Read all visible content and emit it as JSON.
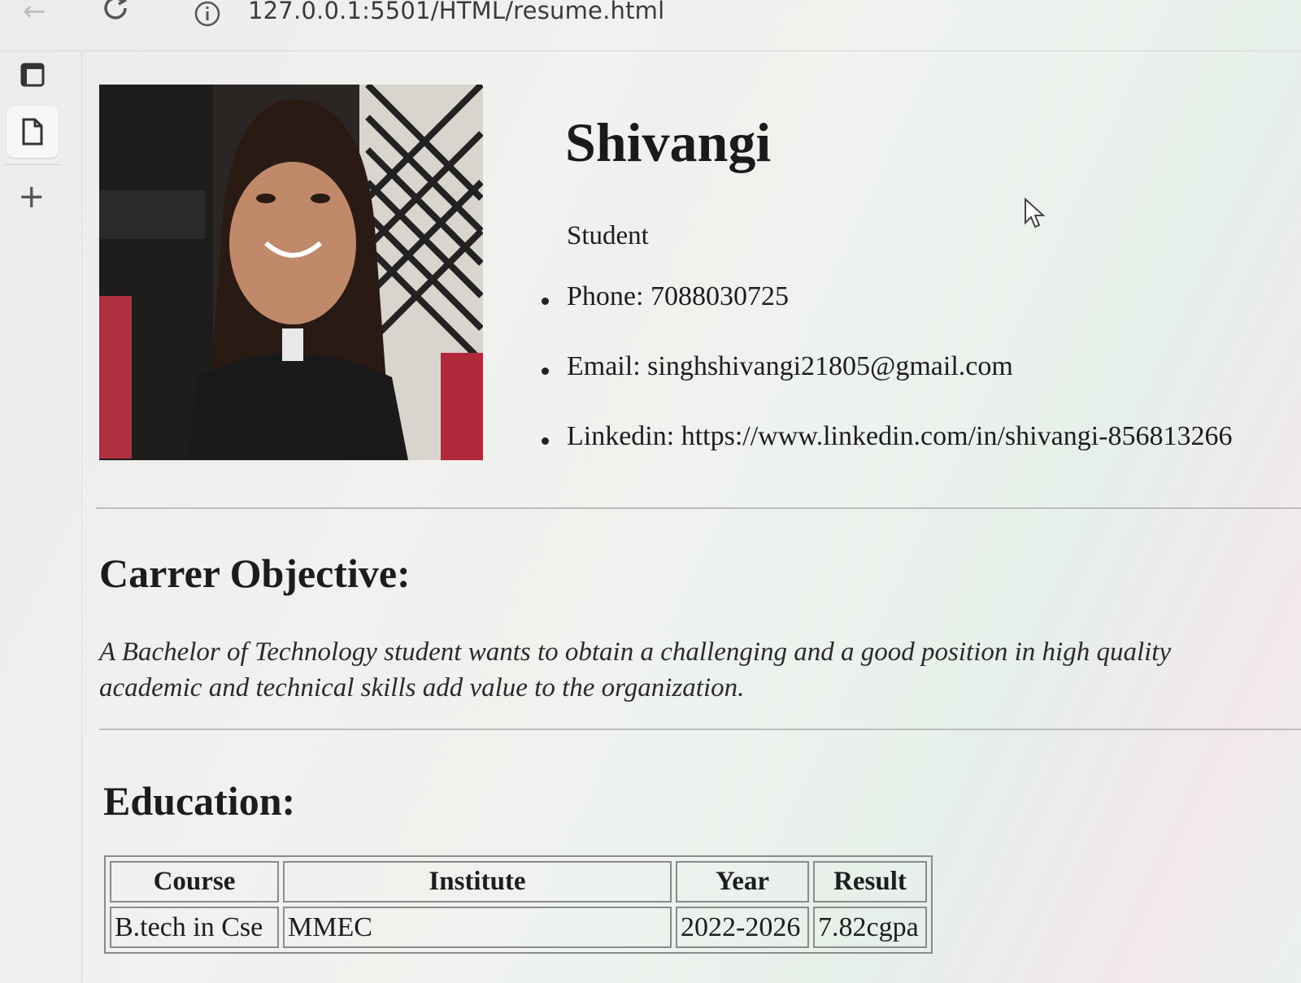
{
  "browser": {
    "url": "127.0.0.1:5501/HTML/resume.html",
    "icons": {
      "back": "arrow-left-icon",
      "reload": "reload-icon",
      "info": "info-icon"
    }
  },
  "sidebar": {
    "items": [
      {
        "icon": "tab-window-icon"
      },
      {
        "icon": "document-icon",
        "active": true
      },
      {
        "icon": "plus-icon"
      }
    ]
  },
  "profile": {
    "name": "Shivangi",
    "role": "Student",
    "contacts": [
      "Phone: 7088030725",
      "Email: singhshivangi21805@gmail.com",
      "Linkedin: https://www.linkedin.com/in/shivangi-856813266"
    ]
  },
  "objective": {
    "heading": "Carrer Objective:",
    "line1": "A Bachelor of Technology student wants to obtain a challenging and a good position in high quality",
    "line2": "academic and technical skills add value to the organization."
  },
  "education": {
    "heading": "Education:",
    "headers": [
      "Course",
      "Institute",
      "Year",
      "Result"
    ],
    "rows": [
      [
        "B.tech in Cse",
        "MMEC",
        "2022-2026",
        "7.82cgpa"
      ]
    ]
  }
}
